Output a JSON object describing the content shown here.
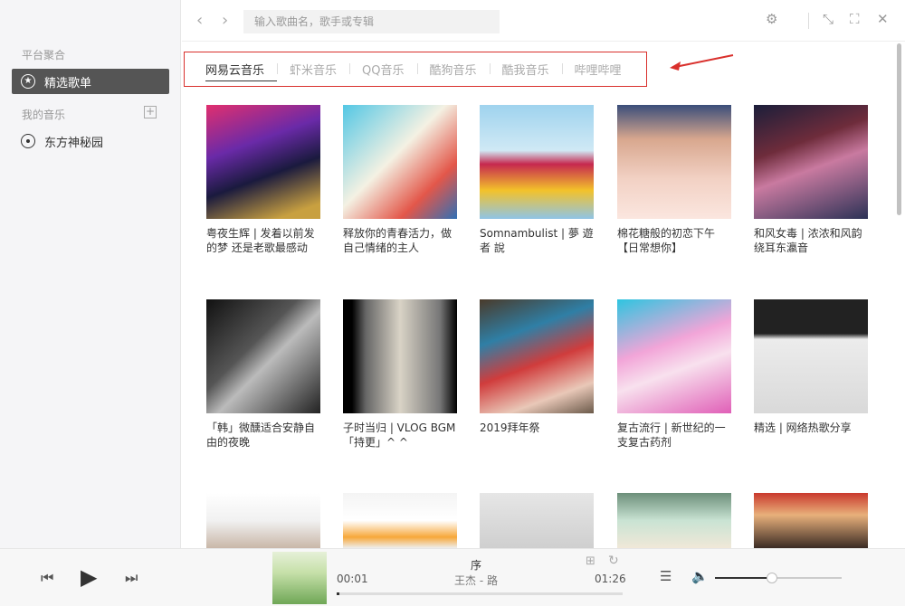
{
  "sidebar": {
    "section_platform": "平台聚合",
    "featured_playlists": "精选歌单",
    "section_my_music": "我的音乐",
    "add_label": "+",
    "my_playlist": "东方神秘园"
  },
  "topbar": {
    "back_label": "‹",
    "forward_label": "›",
    "search_placeholder": "输入歌曲名，歌手或专辑"
  },
  "tabs": [
    "网易云音乐",
    "虾米音乐",
    "QQ音乐",
    "酷狗音乐",
    "酷我音乐",
    "哔哩哔哩"
  ],
  "playlists": [
    {
      "title": "粤夜生辉 | 发着以前发的梦 还是老歌最感动"
    },
    {
      "title": "释放你的青春活力，做自己情绪的主人"
    },
    {
      "title": "Somnambulist | 夢 遊 者 說"
    },
    {
      "title": "棉花糖般的初恋下午【日常想你】"
    },
    {
      "title": "和风女毒 | 浓浓和风韵 绕耳东瀛音"
    },
    {
      "title": "「韩」微醺适合安静自由的夜晚"
    },
    {
      "title": "子时当归 | VLOG BGM「持更」^ ^"
    },
    {
      "title": "2019拜年祭"
    },
    {
      "title": "复古流行 | 新世纪的一支复古药剂"
    },
    {
      "title": "精选 | 网络热歌分享"
    },
    {
      "title": ""
    },
    {
      "title": ""
    },
    {
      "title": ""
    },
    {
      "title": ""
    },
    {
      "title": ""
    }
  ],
  "player": {
    "song_title": "序",
    "artist_album": "王杰 - 路",
    "current_time": "00:01",
    "total_time": "01:26",
    "progress": 0.01,
    "volume": 0.45
  },
  "colors": {
    "accent": "#d9302c",
    "sidebar_active": "#555555"
  }
}
